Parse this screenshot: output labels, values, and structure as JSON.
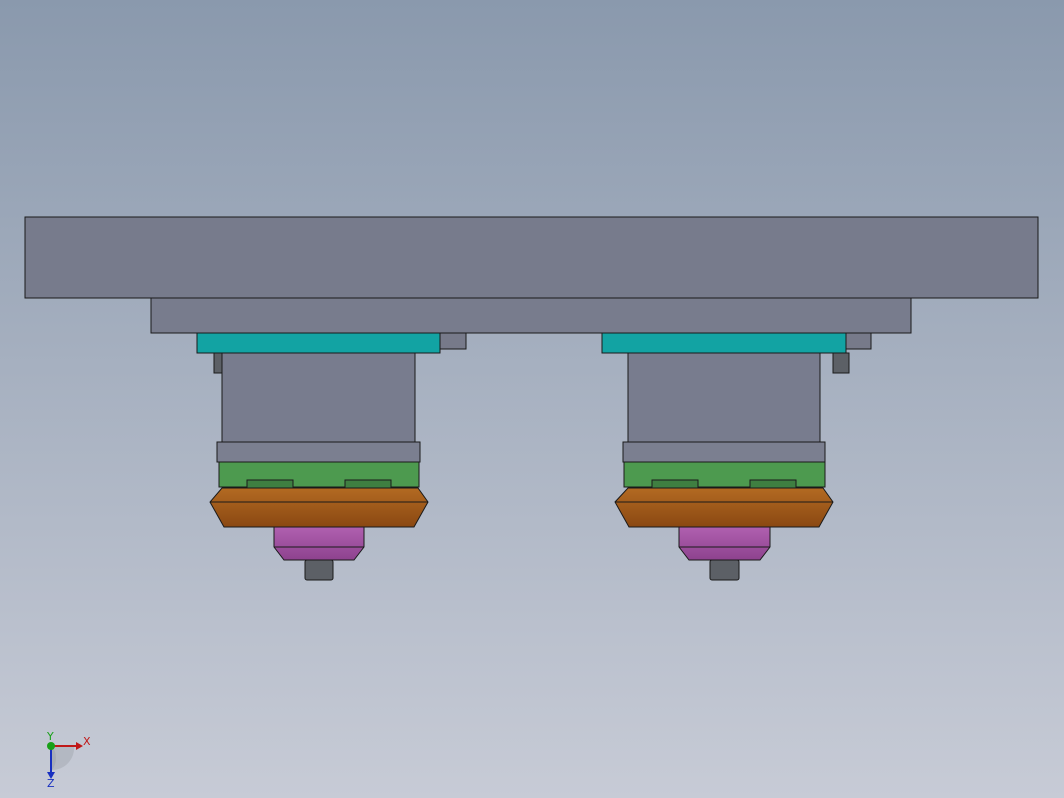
{
  "viewport": {
    "background_top": "#8a99ad",
    "background_bottom": "#c7cbd6"
  },
  "colors": {
    "base_plate": "#777b8c",
    "mid_plate": "#787c8d",
    "outline": "#1a1a1a",
    "teal_flange": "#12a3a3",
    "small_block": "#777a8a",
    "motor_body": "#787c8e",
    "motor_collar": "#7b7f90",
    "green_coupling": "#4d9a4f",
    "green_detail": "#3f7f41",
    "orange_cone": "#a45c1a",
    "orange_cone_dark": "#7a3f0d",
    "purple_hub": "#a552a6",
    "purple_hub_dark": "#7e3a80",
    "gray_shaft": "#5c6066",
    "axis_x": "#c01818",
    "axis_y": "#18a018",
    "axis_z": "#1830c0"
  },
  "triad": {
    "x_label": "X",
    "y_label": "Y",
    "z_label": "Z",
    "icon": "coordinate-triad-icon"
  },
  "assemblies": [
    {
      "name": "left-spindle-assembly"
    },
    {
      "name": "right-spindle-assembly"
    }
  ]
}
